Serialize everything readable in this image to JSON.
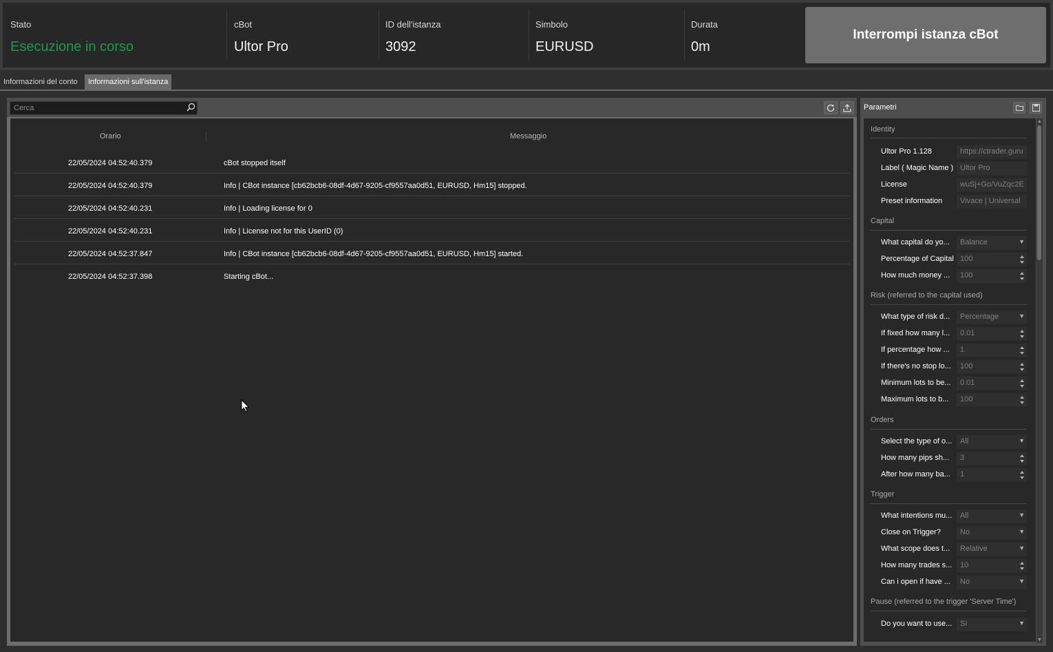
{
  "header": {
    "status_label": "Stato",
    "status_value": "Esecuzione in corso",
    "cbot_label": "cBot",
    "cbot_value": "Ultor Pro",
    "instance_label": "ID dell'istanza",
    "instance_value": "3092",
    "symbol_label": "Simbolo",
    "symbol_value": "EURUSD",
    "duration_label": "Durata",
    "duration_value": "0m",
    "stop_button": "Interrompi istanza cBot"
  },
  "tabs": [
    {
      "label": "Informazioni del conto",
      "active": false
    },
    {
      "label": "Informazioni sull'istanza",
      "active": true
    }
  ],
  "log": {
    "search_placeholder": "Cerca",
    "columns": {
      "time": "Orario",
      "message": "Messaggio"
    },
    "rows": [
      {
        "time": "22/05/2024 04:52:40.379",
        "message": "cBot stopped itself"
      },
      {
        "time": "22/05/2024 04:52:40.379",
        "message": "Info | CBot instance [cb62bcb6-08df-4d67-9205-cf9557aa0d51, EURUSD, Hm15] stopped."
      },
      {
        "time": "22/05/2024 04:52:40.231",
        "message": "Info | Loading license for 0"
      },
      {
        "time": "22/05/2024 04:52:40.231",
        "message": "Info | License not for this UserID (0)"
      },
      {
        "time": "22/05/2024 04:52:37.847",
        "message": "Info | CBot instance [cb62bcb6-08df-4d67-9205-cf9557aa0d51, EURUSD, Hm15] started."
      },
      {
        "time": "22/05/2024 04:52:37.398",
        "message": "Starting cBot..."
      }
    ]
  },
  "params": {
    "title": "Parametri",
    "sections": [
      {
        "title": "Identity",
        "rows": [
          {
            "label": "Ultor Pro 1.128",
            "value": "https://ctrader.guru",
            "kind": "text"
          },
          {
            "label": "Label ( Magic Name )",
            "value": "Ultor Pro",
            "kind": "text"
          },
          {
            "label": "License",
            "value": "wuSj+Go/VuZqc2E",
            "kind": "text"
          },
          {
            "label": "Preset information",
            "value": "Vivace | Universal",
            "kind": "text"
          }
        ]
      },
      {
        "title": "Capital",
        "rows": [
          {
            "label": "What capital do yo...",
            "value": "Balance",
            "kind": "select"
          },
          {
            "label": "Percentage of Capital",
            "value": "100",
            "kind": "number"
          },
          {
            "label": "How much money ...",
            "value": "100",
            "kind": "number"
          }
        ]
      },
      {
        "title": "Risk (referred to the capital used)",
        "rows": [
          {
            "label": "What type of risk d...",
            "value": "Percentage",
            "kind": "select"
          },
          {
            "label": "If fixed how many l...",
            "value": "0.01",
            "kind": "number"
          },
          {
            "label": "If percentage how ...",
            "value": "1",
            "kind": "number"
          },
          {
            "label": "If there's no stop lo...",
            "value": "100",
            "kind": "number"
          },
          {
            "label": "Minimum lots to be...",
            "value": "0.01",
            "kind": "number"
          },
          {
            "label": "Maximum lots to b...",
            "value": "100",
            "kind": "number"
          }
        ]
      },
      {
        "title": "Orders",
        "rows": [
          {
            "label": "Select the type of o...",
            "value": "All",
            "kind": "select"
          },
          {
            "label": "How many pips sh...",
            "value": "3",
            "kind": "number"
          },
          {
            "label": "After how many ba...",
            "value": "1",
            "kind": "number"
          }
        ]
      },
      {
        "title": "Trigger",
        "rows": [
          {
            "label": "What intentions mu...",
            "value": "All",
            "kind": "select"
          },
          {
            "label": "Close on Trigger?",
            "value": "No",
            "kind": "select"
          },
          {
            "label": "What scope does t...",
            "value": "Relative",
            "kind": "select"
          },
          {
            "label": "How many trades s...",
            "value": "10",
            "kind": "number"
          },
          {
            "label": "Can i open if have ...",
            "value": "No",
            "kind": "select"
          }
        ]
      },
      {
        "title": "Pause (referred to the trigger 'Server Time')",
        "rows": [
          {
            "label": "Do you want to use...",
            "value": "Sì",
            "kind": "select"
          }
        ]
      }
    ]
  }
}
